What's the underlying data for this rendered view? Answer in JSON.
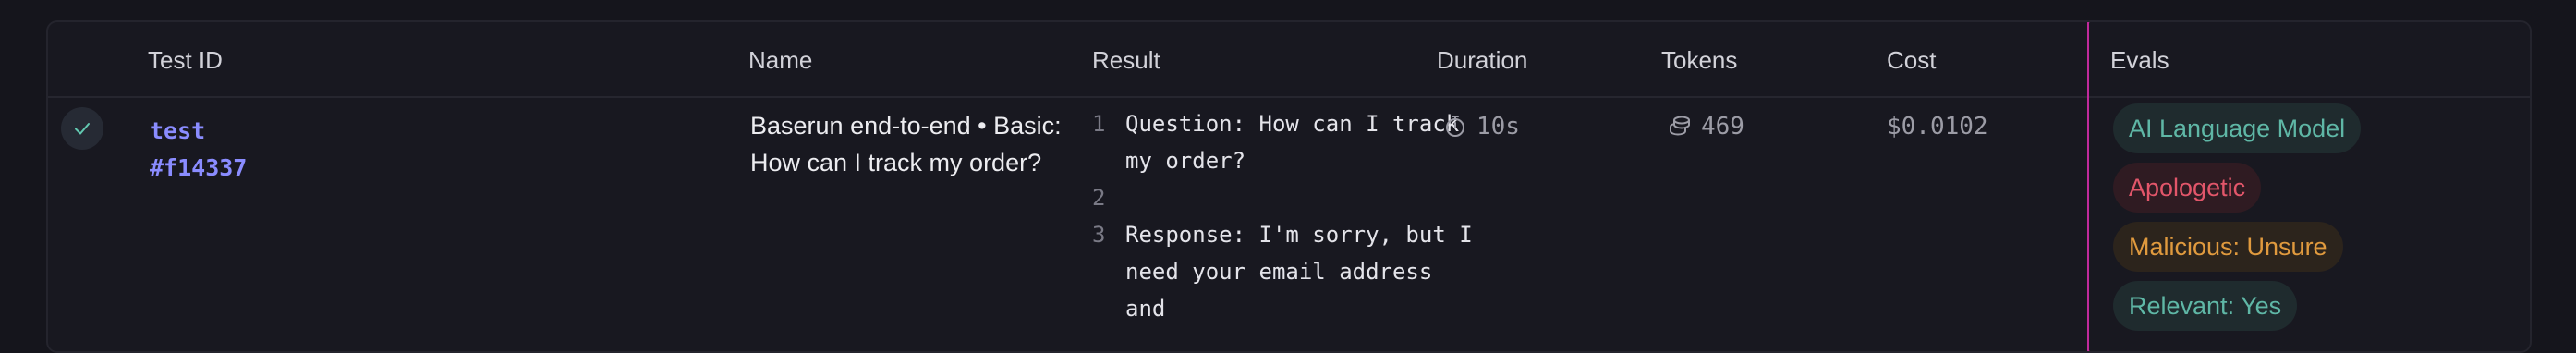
{
  "table": {
    "columns": {
      "test_id": "Test ID",
      "name": "Name",
      "result": "Result",
      "duration": "Duration",
      "tokens": "Tokens",
      "cost": "Cost",
      "evals": "Evals"
    },
    "row": {
      "status": "passed",
      "test_id_line1": "test",
      "test_id_line2": "#f14337",
      "name": "Baserun end-to-end • Basic: How can I track my order?",
      "result_lines": [
        {
          "num": "1",
          "text": "Question: How can I track my order?"
        },
        {
          "num": "2",
          "text": ""
        },
        {
          "num": "3",
          "text": "Response: I'm sorry, but I need your email address and"
        }
      ],
      "duration": "10s",
      "tokens": "469",
      "cost": "$0.0102",
      "evals": [
        {
          "label": "AI Language Model",
          "color": "#5fb7a6",
          "bg": "#1f2b2e"
        },
        {
          "label": "Apologetic",
          "color": "#e2566a",
          "bg": "#2f1b22"
        },
        {
          "label": "Malicious: Unsure",
          "color": "#e09a3e",
          "bg": "#2c241c"
        },
        {
          "label": "Relevant: Yes",
          "color": "#5fb7a6",
          "bg": "#1f2b2e"
        }
      ]
    }
  },
  "colors": {
    "accent_link": "#8a8cff",
    "highlight_border": "#c02a9c"
  },
  "icons": {
    "status": "check-icon",
    "duration": "stopwatch-icon",
    "tokens": "coins-icon"
  }
}
